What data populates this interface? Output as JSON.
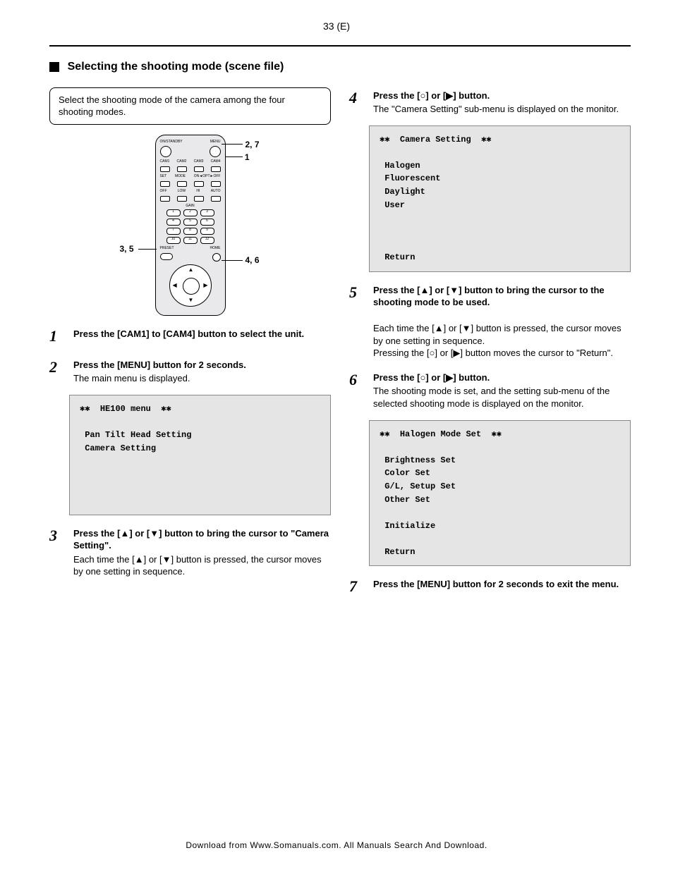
{
  "page_number_top": "33 (E)",
  "section_title": "Selecting the shooting mode (scene file)",
  "intro_text": "Select the shooting mode of the camera among the four shooting modes.",
  "remote_leaders": {
    "l1": "2, 7",
    "l2": "1",
    "l3": "3, 5",
    "l4": "4, 6"
  },
  "steps_left": [
    {
      "num": "1",
      "head": "Press the [CAM1] to [CAM4] button to select the unit.",
      "body": ""
    },
    {
      "num": "2",
      "head": "Press the [MENU] button for 2 seconds.",
      "body": "The main menu is displayed."
    },
    {
      "num": "3",
      "head_parts": [
        "Press the [",
        "▲",
        "] or [",
        "▼",
        "] button to bring the cursor to \"Camera Setting\"."
      ],
      "body_parts": [
        "Each time the [",
        "▲",
        "] or [",
        "▼",
        "] button is pressed, the cursor moves by one setting in sequence."
      ]
    }
  ],
  "steps_right": [
    {
      "num": "4",
      "head_parts": [
        "Press the [",
        "○",
        "] or [",
        "▶",
        "] button."
      ],
      "body": "The \"Camera Setting\" sub-menu is displayed on the monitor."
    },
    {
      "num": "5",
      "head_parts": [
        "Press the [",
        "▲",
        "] or [",
        "▼",
        "] button to bring the cursor to the shooting mode to be used."
      ],
      "body_parts": [
        "Each time the [",
        "▲",
        "] or [",
        "▼",
        "] button is pressed, the cursor moves by one setting in sequence.\nPressing the [",
        "○",
        "] or [",
        "▶",
        "] button moves the cursor to \"Return\"."
      ]
    },
    {
      "num": "6",
      "head_parts": [
        "Press the [",
        "○",
        "] or [",
        "▶",
        "] button."
      ],
      "body": "The shooting mode is set, and the setting sub-menu of the selected shooting mode is displayed on the monitor."
    },
    {
      "num": "7",
      "head": "Press the [MENU] button for 2 seconds to exit the menu.",
      "body": ""
    }
  ],
  "screen1": {
    "title": "  HE100 menu  ",
    "l1": " Pan Tilt Head Setting",
    "l2": " Camera Setting"
  },
  "screen2": {
    "title": "  Camera Setting  ",
    "l1": " Halogen",
    "l2": " Fluorescent",
    "l3": " Daylight",
    "l4": " User",
    "ret": " Return"
  },
  "screen3": {
    "title": "  Halogen Mode Set  ",
    "l1": " Brightness Set",
    "l2": " Color Set",
    "l3": " G/L, Setup Set",
    "l4": " Other Set",
    "init": " Initialize",
    "ret": " Return"
  },
  "footer": "Download from Www.Somanuals.com. All Manuals Search And Download."
}
